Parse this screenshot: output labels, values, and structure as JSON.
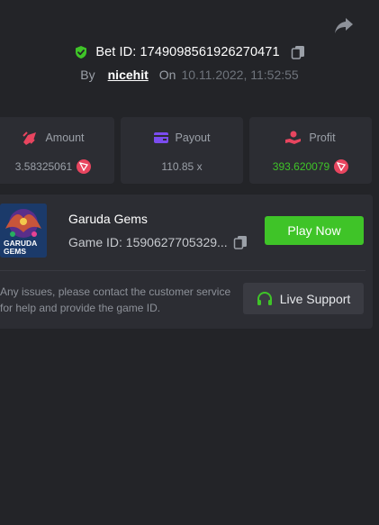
{
  "bet": {
    "id_text": "Bet ID: 1749098561926270471",
    "by_label": "By",
    "username": "nicehit",
    "on_label": "On",
    "datetime": "10.11.2022, 11:52:55"
  },
  "stats": {
    "amount": {
      "label": "Amount",
      "value": "3.58325061",
      "icon": "rocket-icon"
    },
    "payout": {
      "label": "Payout",
      "value": "110.85 x",
      "icon": "wallet-icon"
    },
    "profit": {
      "label": "Profit",
      "value": "393.620079",
      "icon": "hand-coin-icon"
    }
  },
  "game": {
    "title": "Garuda Gems",
    "id_text": "Game ID: 1590627705329...",
    "thumb_line1": "GARUDA",
    "thumb_line2": "GEMS",
    "play_label": "Play Now"
  },
  "support": {
    "help_text": "Any issues, please contact the customer service for help and provide the game ID.",
    "button_label": "Live Support"
  },
  "colors": {
    "background": "#232428",
    "card": "#2c2d33",
    "accent_green": "#3fc428",
    "amount_icon": "#e8455f",
    "payout_icon": "#7b4cf0",
    "profit_icon": "#e8455f"
  }
}
